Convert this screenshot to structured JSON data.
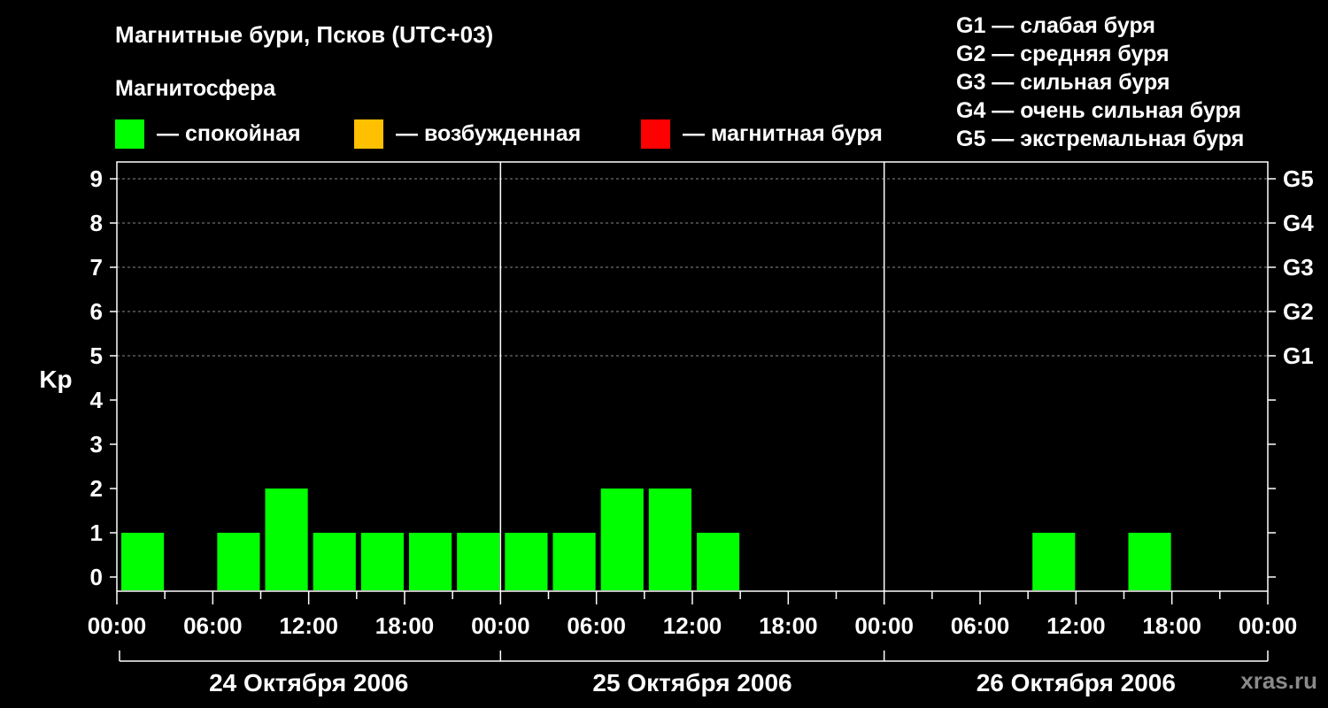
{
  "title": "Магнитные бури, Псков (UTC+03)",
  "subtitle": "Магнитосфера",
  "legend": [
    {
      "label": "— спокойная",
      "color": "#00ff00"
    },
    {
      "label": "— возбужденная",
      "color": "#ffc000"
    },
    {
      "label": "— магнитная буря",
      "color": "#ff0000"
    }
  ],
  "storm_levels": [
    "G1 — слабая буря",
    "G2 — средняя буря",
    "G3 — сильная буря",
    "G4 — очень сильная буря",
    "G5 — экстремальная буря"
  ],
  "watermark": "xras.ru",
  "chart_data": {
    "type": "bar",
    "ylabel": "Kp",
    "ylim": [
      0,
      9
    ],
    "y_ticks": [
      "0",
      "1",
      "2",
      "3",
      "4",
      "5",
      "6",
      "7",
      "8",
      "9"
    ],
    "right_ticks": [
      {
        "y": 5,
        "label": "G1"
      },
      {
        "y": 6,
        "label": "G2"
      },
      {
        "y": 7,
        "label": "G3"
      },
      {
        "y": 8,
        "label": "G4"
      },
      {
        "y": 9,
        "label": "G5"
      }
    ],
    "x_tick_labels": [
      "00:00",
      "06:00",
      "12:00",
      "18:00",
      "00:00",
      "06:00",
      "12:00",
      "18:00",
      "00:00",
      "06:00",
      "12:00",
      "18:00",
      "00:00"
    ],
    "days": [
      "24 Октября 2006",
      "25 Октября 2006",
      "26 Октября 2006"
    ],
    "interval_hours": 3,
    "kp": [
      1,
      0,
      1,
      2,
      1,
      1,
      1,
      1,
      1,
      1,
      2,
      2,
      1,
      0,
      0,
      0,
      0,
      0,
      0,
      1,
      0,
      1,
      0,
      0
    ],
    "bar_color": "#00ff00",
    "grid_dashed_at": [
      5,
      6,
      7,
      8,
      9
    ]
  }
}
